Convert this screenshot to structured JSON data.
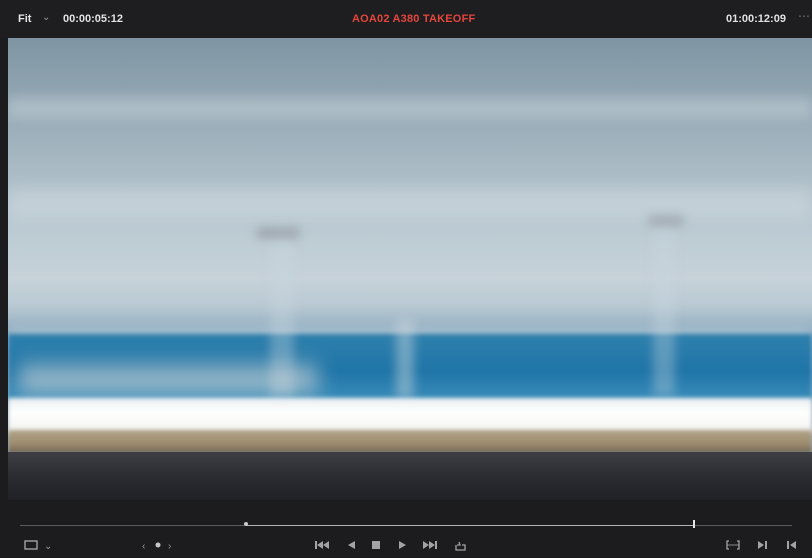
{
  "viewer": {
    "zoom_label": "Fit",
    "source_timecode": "00:00:05:12",
    "clip_title": "AOA02 A380 TAKEOFF",
    "record_timecode": "01:00:12:09"
  },
  "transport": {
    "icons": [
      "view-options-icon",
      "prev-marker-icon",
      "marker-dot-icon",
      "next-marker-icon",
      "jump-start-icon",
      "play-reverse-icon",
      "stop-icon",
      "play-icon",
      "jump-end-icon",
      "loop-icon",
      "match-frame-icon",
      "next-edit-icon",
      "prev-edit-icon"
    ],
    "playhead_in_fraction": 0.29,
    "playhead_out_fraction": 0.87
  },
  "colors": {
    "title_red": "#e4463c",
    "background": "#1c1c1e",
    "timecode": "#e2e2e2"
  }
}
